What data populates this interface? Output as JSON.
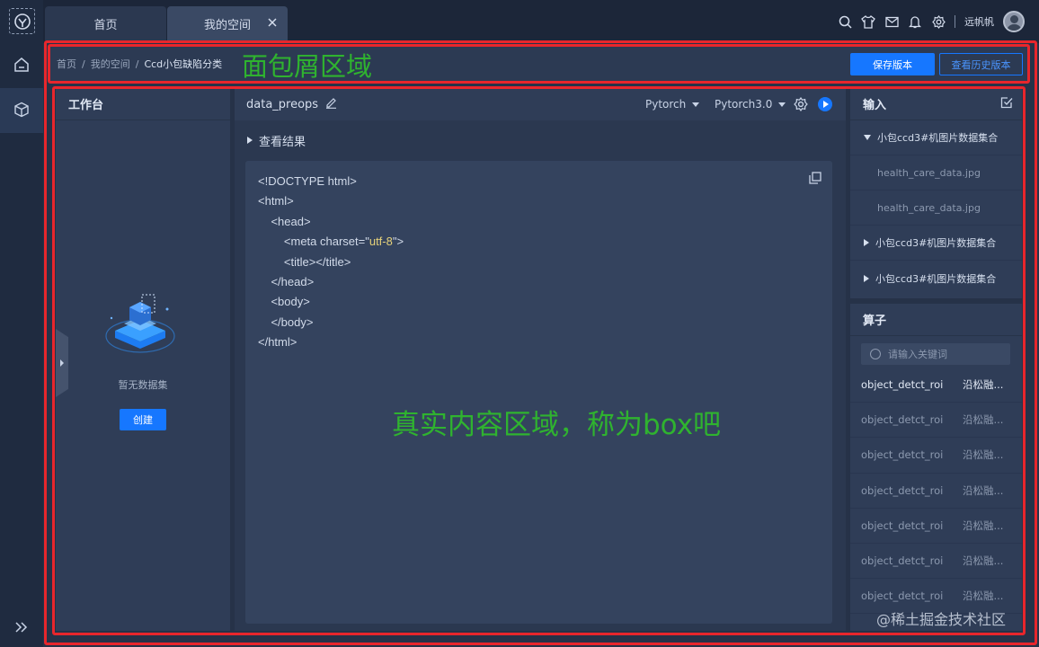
{
  "tabs": [
    {
      "label": "首页"
    },
    {
      "label": "我的空间"
    }
  ],
  "header": {
    "username": "远帆帆"
  },
  "breadcrumb": {
    "items": [
      "首页",
      "我的空间",
      "Ccd小包缺陷分类"
    ],
    "separator": "/"
  },
  "annotations": {
    "breadcrumb_area": "面包屑区域",
    "content_area": "真实内容区域，称为box吧"
  },
  "actions": {
    "save_version": "保存版本",
    "view_history": "查看历史版本"
  },
  "workbench": {
    "title": "工作台",
    "empty_text": "暂无数据集",
    "create_label": "创建"
  },
  "editor": {
    "filename": "data_preops",
    "framework": "Pytorch",
    "version": "Pytorch3.0",
    "result_label": "查看结果",
    "code_lines": [
      "<!DOCTYPE html>",
      "<html>",
      "    <head>",
      "        <meta charset=\"utf-8\">",
      "        <title></title>",
      "    </head>",
      "    <body>",
      "    </body>",
      "</html>"
    ]
  },
  "input_panel": {
    "title": "输入",
    "groups": [
      {
        "label": "小包ccd3#机图片数据集合",
        "expanded": true,
        "files": [
          "health_care_data.jpg",
          "health_care_data.jpg"
        ]
      },
      {
        "label": "小包ccd3#机图片数据集合",
        "expanded": false,
        "files": []
      },
      {
        "label": "小包ccd3#机图片数据集合",
        "expanded": false,
        "files": []
      }
    ]
  },
  "operator_panel": {
    "title": "算子",
    "search_placeholder": "请输入关键词",
    "items": [
      {
        "name": "object_detct_roi",
        "author": "沿松融..."
      },
      {
        "name": "object_detct_roi",
        "author": "沿松融..."
      },
      {
        "name": "object_detct_roi",
        "author": "沿松融..."
      },
      {
        "name": "object_detct_roi",
        "author": "沿松融..."
      },
      {
        "name": "object_detct_roi",
        "author": "沿松融..."
      },
      {
        "name": "object_detct_roi",
        "author": "沿松融..."
      },
      {
        "name": "object_detct_roi",
        "author": "沿松融..."
      }
    ]
  },
  "watermark": "@稀土掘金技术社区",
  "colors": {
    "accent": "#1677ff",
    "annotation_border": "#e8262c",
    "annotation_text": "#2fb32f",
    "code_string": "#e6d27a"
  },
  "icons": [
    "logo-icon",
    "home-icon",
    "box-icon",
    "collapse-icon",
    "close-icon",
    "search-icon",
    "shirt-icon",
    "mail-icon",
    "bell-icon",
    "gear-icon",
    "edit-icon",
    "run-icon",
    "copy-icon",
    "check-square-icon"
  ]
}
